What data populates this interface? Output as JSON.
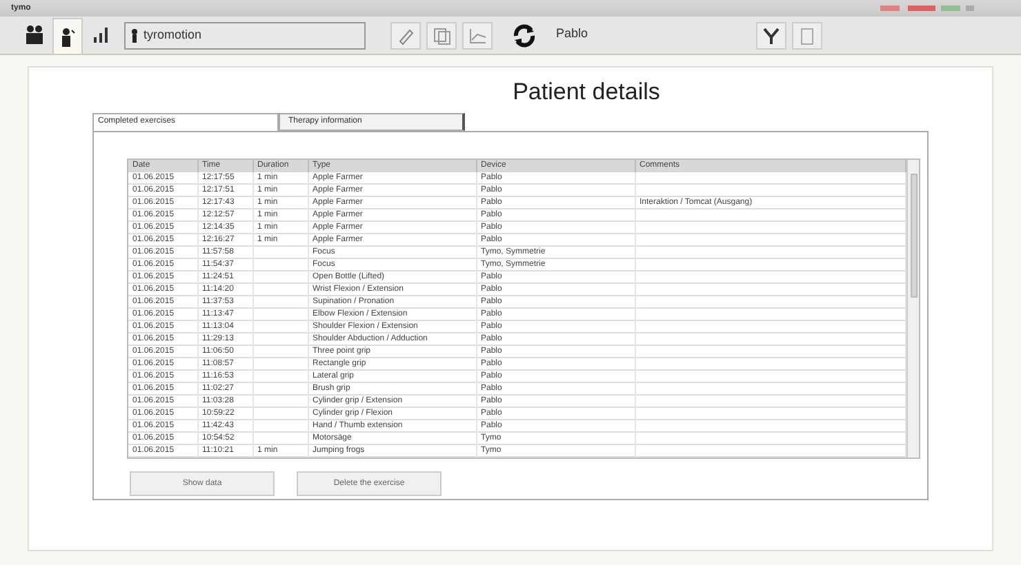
{
  "window": {
    "title": "tymo"
  },
  "toolbar": {
    "tabs": [
      {
        "kind": "patients",
        "selected": false
      },
      {
        "kind": "patient",
        "selected": true
      },
      {
        "kind": "statistics",
        "selected": false
      }
    ],
    "patient_field": {
      "value": "tyromotion"
    },
    "device": "Pablo"
  },
  "page_title": "Patient details",
  "tabs": [
    {
      "label": "Completed exercises",
      "selected": true
    },
    {
      "label": "Therapy information",
      "selected": false
    }
  ],
  "table": {
    "columns": [
      "Date",
      "Time",
      "Duration",
      "Type",
      "Device",
      "Comments"
    ],
    "rows": [
      [
        "01.06.2015",
        "12:17:55",
        "1 min",
        "Apple Farmer",
        "Pablo",
        ""
      ],
      [
        "01.06.2015",
        "12:17:51",
        "1 min",
        "Apple Farmer",
        "Pablo",
        ""
      ],
      [
        "01.06.2015",
        "12:17:43",
        "1 min",
        "Apple Farmer",
        "Pablo",
        "Interaktion / Tomcat (Ausgang)"
      ],
      [
        "01.06.2015",
        "12:12:57",
        "1 min",
        "Apple Farmer",
        "Pablo",
        ""
      ],
      [
        "01.06.2015",
        "12:14:35",
        "1 min",
        "Apple Farmer",
        "Pablo",
        ""
      ],
      [
        "01.06.2015",
        "12:16:27",
        "1 min",
        "Apple Farmer",
        "Pablo",
        ""
      ],
      [
        "01.06.2015",
        "11:57:58",
        "",
        "Focus",
        "Tymo, Symmetrie",
        ""
      ],
      [
        "01.06.2015",
        "11:54:37",
        "",
        "Focus",
        "Tymo, Symmetrie",
        ""
      ],
      [
        "01.06.2015",
        "11:24:51",
        "",
        "Open Bottle (Lifted)",
        "Pablo",
        ""
      ],
      [
        "01.06.2015",
        "11:14:20",
        "",
        "Wrist Flexion / Extension",
        "Pablo",
        ""
      ],
      [
        "01.06.2015",
        "11:37:53",
        "",
        "Supination / Pronation",
        "Pablo",
        ""
      ],
      [
        "01.06.2015",
        "11:13:47",
        "",
        "Elbow Flexion / Extension",
        "Pablo",
        ""
      ],
      [
        "01.06.2015",
        "11:13:04",
        "",
        "Shoulder Flexion / Extension",
        "Pablo",
        ""
      ],
      [
        "01.06.2015",
        "11:29:13",
        "",
        "Shoulder Abduction / Adduction",
        "Pablo",
        ""
      ],
      [
        "01.06.2015",
        "11:06:50",
        "",
        "Three point grip",
        "Pablo",
        ""
      ],
      [
        "01.06.2015",
        "11:08:57",
        "",
        "Rectangle grip",
        "Pablo",
        ""
      ],
      [
        "01.06.2015",
        "11:16:53",
        "",
        "Lateral grip",
        "Pablo",
        ""
      ],
      [
        "01.06.2015",
        "11:02:27",
        "",
        "Brush grip",
        "Pablo",
        ""
      ],
      [
        "01.06.2015",
        "11:03:28",
        "",
        "Cylinder grip / Extension",
        "Pablo",
        ""
      ],
      [
        "01.06.2015",
        "10:59:22",
        "",
        "Cylinder grip / Flexion",
        "Pablo",
        ""
      ],
      [
        "01.06.2015",
        "11:42:43",
        "",
        "Hand / Thumb extension",
        "Pablo",
        ""
      ],
      [
        "01.06.2015",
        "10:54:52",
        "",
        "Motorsäge",
        "Tymo",
        ""
      ],
      [
        "01.06.2015",
        "11:10:21",
        "1 min",
        "Jumping frogs",
        "Tymo",
        ""
      ]
    ]
  },
  "buttons": [
    "Show data",
    "Delete the exercise"
  ]
}
